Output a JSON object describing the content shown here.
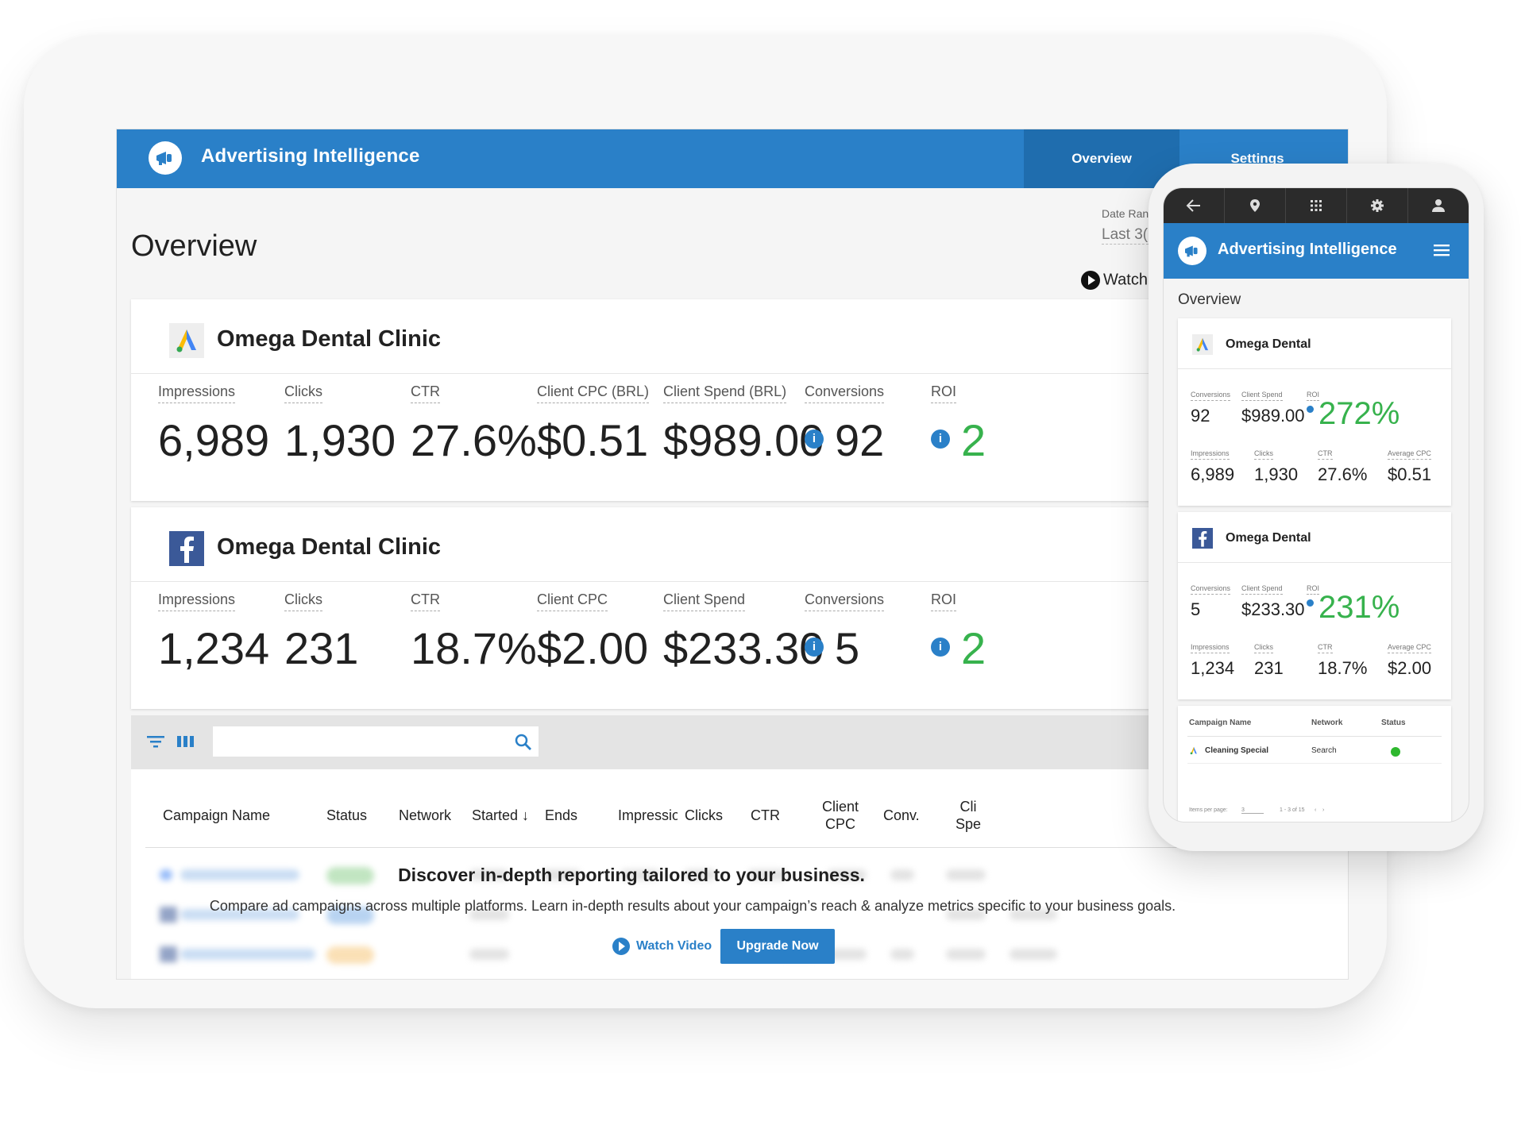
{
  "app": {
    "title": "Advertising Intelligence",
    "tabs": [
      {
        "label": "Overview",
        "active": true
      },
      {
        "label": "Settings",
        "active": false
      }
    ],
    "accent": "#2a80c8",
    "positive_color": "#37b24d"
  },
  "page": {
    "title": "Overview",
    "date_range_label": "Date Range",
    "date_range_value": "Last 3(",
    "watch_label": "Watch"
  },
  "cards": [
    {
      "source_icon": "google-ads-icon",
      "title": "Omega Dental Clinic",
      "metrics": [
        {
          "label": "Impressions",
          "value": "6,989"
        },
        {
          "label": "Clicks",
          "value": "1,930"
        },
        {
          "label": "CTR",
          "value": "27.6%"
        },
        {
          "label": "Client CPC (BRL)",
          "value": "$0.51"
        },
        {
          "label": "Client Spend (BRL)",
          "value": "$989.00"
        },
        {
          "label": "Conversions",
          "value": "92"
        },
        {
          "label": "ROI",
          "value": "2"
        }
      ]
    },
    {
      "source_icon": "facebook-icon",
      "title": "Omega Dental Clinic",
      "metrics": [
        {
          "label": "Impressions",
          "value": "1,234"
        },
        {
          "label": "Clicks",
          "value": "231"
        },
        {
          "label": "CTR",
          "value": "18.7%"
        },
        {
          "label": "Client CPC",
          "value": "$2.00"
        },
        {
          "label": "Client Spend",
          "value": "$233.30"
        },
        {
          "label": "Conversions",
          "value": "5"
        },
        {
          "label": "ROI",
          "value": "2"
        }
      ]
    }
  ],
  "table": {
    "search_placeholder": "",
    "columns": [
      "Campaign Name",
      "Status",
      "Network",
      "Started ↓",
      "Ends",
      "Impressior",
      "Clicks",
      "CTR",
      "Client\nCPC",
      "Conv.",
      "Cli\nSpe"
    ],
    "overlay": {
      "headline": "Discover in-depth reporting tailored to your business.",
      "body": "Compare ad campaigns across multiple platforms. Learn in-depth results about your campaign’s reach & analyze metrics specific to your business goals.",
      "watch_label": "Watch Video",
      "upgrade_label": "Upgrade Now"
    }
  },
  "phone": {
    "app_title": "Advertising Intelligence",
    "page_title": "Overview",
    "status_icons": [
      "back-arrow-icon",
      "location-pin-icon",
      "apps-grid-icon",
      "gear-icon",
      "person-icon"
    ],
    "cards": [
      {
        "source_icon": "google-ads-icon",
        "title": "Omega Dental",
        "top": [
          {
            "label": "Conversions",
            "value": "92"
          },
          {
            "label": "Client Spend",
            "value": "$989.00"
          },
          {
            "label": "ROI",
            "value": "272%"
          }
        ],
        "bottom": [
          {
            "label": "Impressions",
            "value": "6,989"
          },
          {
            "label": "Clicks",
            "value": "1,930"
          },
          {
            "label": "CTR",
            "value": "27.6%"
          },
          {
            "label": "Average CPC",
            "value": "$0.51"
          }
        ]
      },
      {
        "source_icon": "facebook-icon",
        "title": "Omega Dental",
        "top": [
          {
            "label": "Conversions",
            "value": "5"
          },
          {
            "label": "Client Spend",
            "value": "$233.30"
          },
          {
            "label": "ROI",
            "value": "231%"
          }
        ],
        "bottom": [
          {
            "label": "Impressions",
            "value": "1,234"
          },
          {
            "label": "Clicks",
            "value": "231"
          },
          {
            "label": "CTR",
            "value": "18.7%"
          },
          {
            "label": "Average CPC",
            "value": "$2.00"
          }
        ]
      }
    ],
    "table": {
      "columns": [
        "Campaign Name",
        "Network",
        "Status"
      ],
      "row": {
        "name": "Cleaning Special",
        "network": "Search",
        "status_color": "#2eb82e"
      },
      "items_per_page_label": "Items per page:",
      "items_per_page_value": "3",
      "range": "1 - 3 of 15"
    }
  }
}
